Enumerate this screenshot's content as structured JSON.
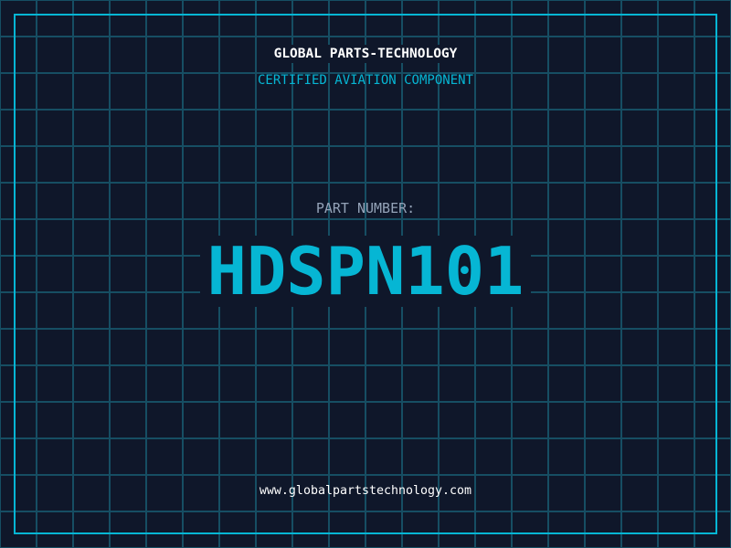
{
  "header": {
    "company": "GLOBAL PARTS-TECHNOLOGY",
    "subtitle": "CERTIFIED AVIATION COMPONENT"
  },
  "part": {
    "label": "PART NUMBER:",
    "number": "HDSPN101"
  },
  "footer": {
    "url": "www.globalpartstechnology.com"
  },
  "colors": {
    "background": "#0f172a",
    "accent": "#06b6d4",
    "grid": "#164e63",
    "label": "#94a3b8"
  }
}
